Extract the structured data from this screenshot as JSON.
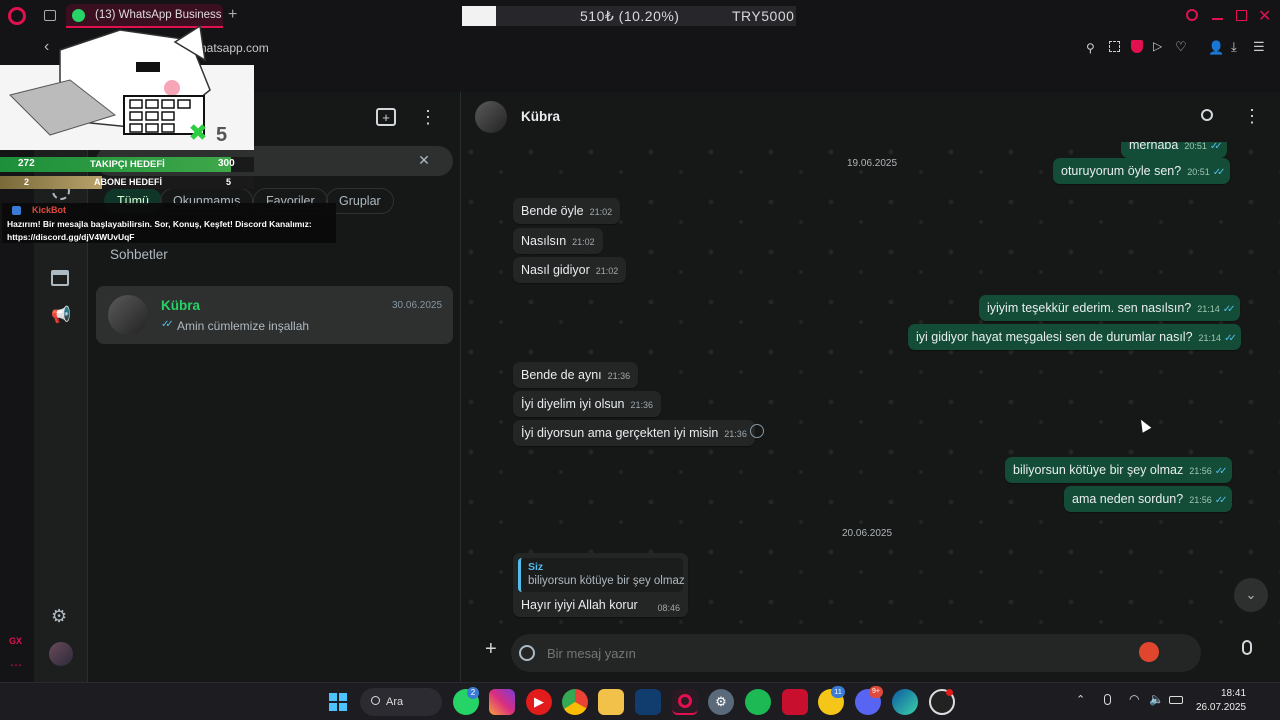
{
  "browser": {
    "tab_title": "(13) WhatsApp Business",
    "url": "hatsapp.com",
    "ticker_text": "510₺ (10.20%)",
    "ticker_goal": "TRY5000"
  },
  "overlay": {
    "follower_goal_current": "272",
    "follower_goal_label": "TAKIPÇI HEDEFİ",
    "follower_goal_target": "300",
    "subscriber_goal_current": "2",
    "subscriber_goal_label": "ABONE HEDEFİ",
    "subscriber_goal_target": "5",
    "bot_name": "KickBot",
    "bot_message": "Hazırım! Bir mesajla başlayabilirsin. Sor, Konuş, Keşfet! Discord Kanalımız: https://discord.gg/djV4WUvUqF",
    "counter_badge": "5",
    "gx_label": "GX"
  },
  "sidebar": {
    "filters": [
      "Tümü",
      "Okunmamış",
      "Favoriler",
      "Gruplar"
    ],
    "section_title": "Sohbetler",
    "chats": [
      {
        "name": "Kübra",
        "date": "30.06.2025",
        "preview": "Amin cümlemize inşallah"
      }
    ]
  },
  "chat": {
    "contact_name": "Kübra",
    "dates": [
      "19.06.2025",
      "20.06.2025"
    ],
    "messages": [
      {
        "dir": "out",
        "text": "merhaba",
        "time": "20:51"
      },
      {
        "dir": "out",
        "text": "oturuyorum öyle sen?",
        "time": "20:51"
      },
      {
        "dir": "in",
        "text": "Bende öyle",
        "time": "21:02"
      },
      {
        "dir": "in",
        "text": "Nasılsın",
        "time": "21:02"
      },
      {
        "dir": "in",
        "text": "Nasıl gidiyor",
        "time": "21:02"
      },
      {
        "dir": "out",
        "text": "iyiyim teşekkür ederim. sen nasılsın?",
        "time": "21:14"
      },
      {
        "dir": "out",
        "text": "iyi gidiyor hayat meşgalesi sen de durumlar nasıl?",
        "time": "21:14"
      },
      {
        "dir": "in",
        "text": "Bende de aynı",
        "time": "21:36"
      },
      {
        "dir": "in",
        "text": "İyi diyelim iyi olsun",
        "time": "21:36"
      },
      {
        "dir": "in",
        "text": "İyi diyorsun ama gerçekten iyi misin",
        "time": "21:36"
      },
      {
        "dir": "out",
        "text": "biliyorsun kötüye bir şey olmaz",
        "time": "21:56"
      },
      {
        "dir": "out",
        "text": "ama neden sordun?",
        "time": "21:56"
      },
      {
        "dir": "in",
        "quote_author": "Siz",
        "quote_text": "biliyorsun kötüye bir şey olmaz",
        "text": "Hayır iyiyi Allah korur",
        "time": "08:46"
      }
    ],
    "input_placeholder": "Bir mesaj yazın"
  },
  "taskbar": {
    "search_label": "Ara",
    "clock_time": "18:41",
    "clock_date": "26.07.2025",
    "whatsapp_badge": "2",
    "norton_badge": "11",
    "discord_badge": "9+"
  },
  "colors": {
    "accent_green": "#25d366",
    "out_bubble": "#144d37",
    "in_bubble": "#242626",
    "opera_red": "#e0114e"
  }
}
